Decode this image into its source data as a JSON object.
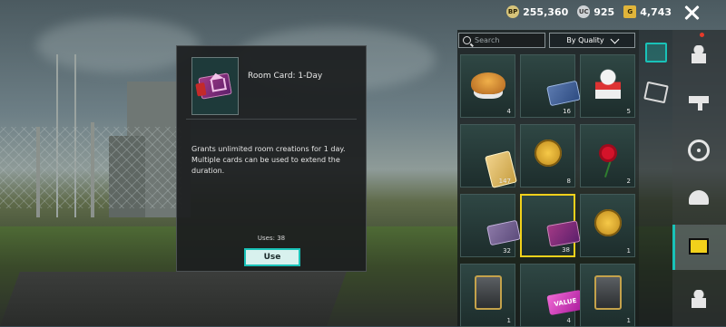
{
  "currency": {
    "bp": {
      "icon_label": "BP",
      "value": "255,360"
    },
    "uc": {
      "icon_label": "UC",
      "value": "925"
    },
    "ag": {
      "icon_label": "G",
      "value": "4,743"
    }
  },
  "detail": {
    "item_name": "Room Card: 1-Day",
    "description": "Grants unlimited room creations for 1 day. Multiple cards can be used to extend the duration.",
    "uses": "Uses: 38",
    "use_label": "Use"
  },
  "inventory": {
    "search_placeholder": "Search",
    "sort_label": "By Quality",
    "items": [
      {
        "icon": "roast-chicken-icon",
        "count": "4"
      },
      {
        "icon": "rename-card-icon",
        "count": "16"
      },
      {
        "icon": "character-figure-icon",
        "count": "5"
      },
      {
        "icon": "room-card-gold-icon",
        "count": "147"
      },
      {
        "icon": "coupon-coin-icon",
        "count": "8"
      },
      {
        "icon": "rose-icon",
        "count": "2"
      },
      {
        "icon": "double-card-icon",
        "count": "32"
      },
      {
        "icon": "room-card-purple-icon",
        "count": "38"
      },
      {
        "icon": "coupon-coin-icon",
        "count": "1"
      },
      {
        "icon": "pass-card-icon",
        "count": "1"
      },
      {
        "icon": "value-card-icon",
        "count": "4",
        "text": "VALUE"
      },
      {
        "icon": "shield-pass-icon",
        "count": "1"
      }
    ]
  },
  "colors": {
    "accent": "#19c2b8",
    "selected": "#f2d11b"
  }
}
